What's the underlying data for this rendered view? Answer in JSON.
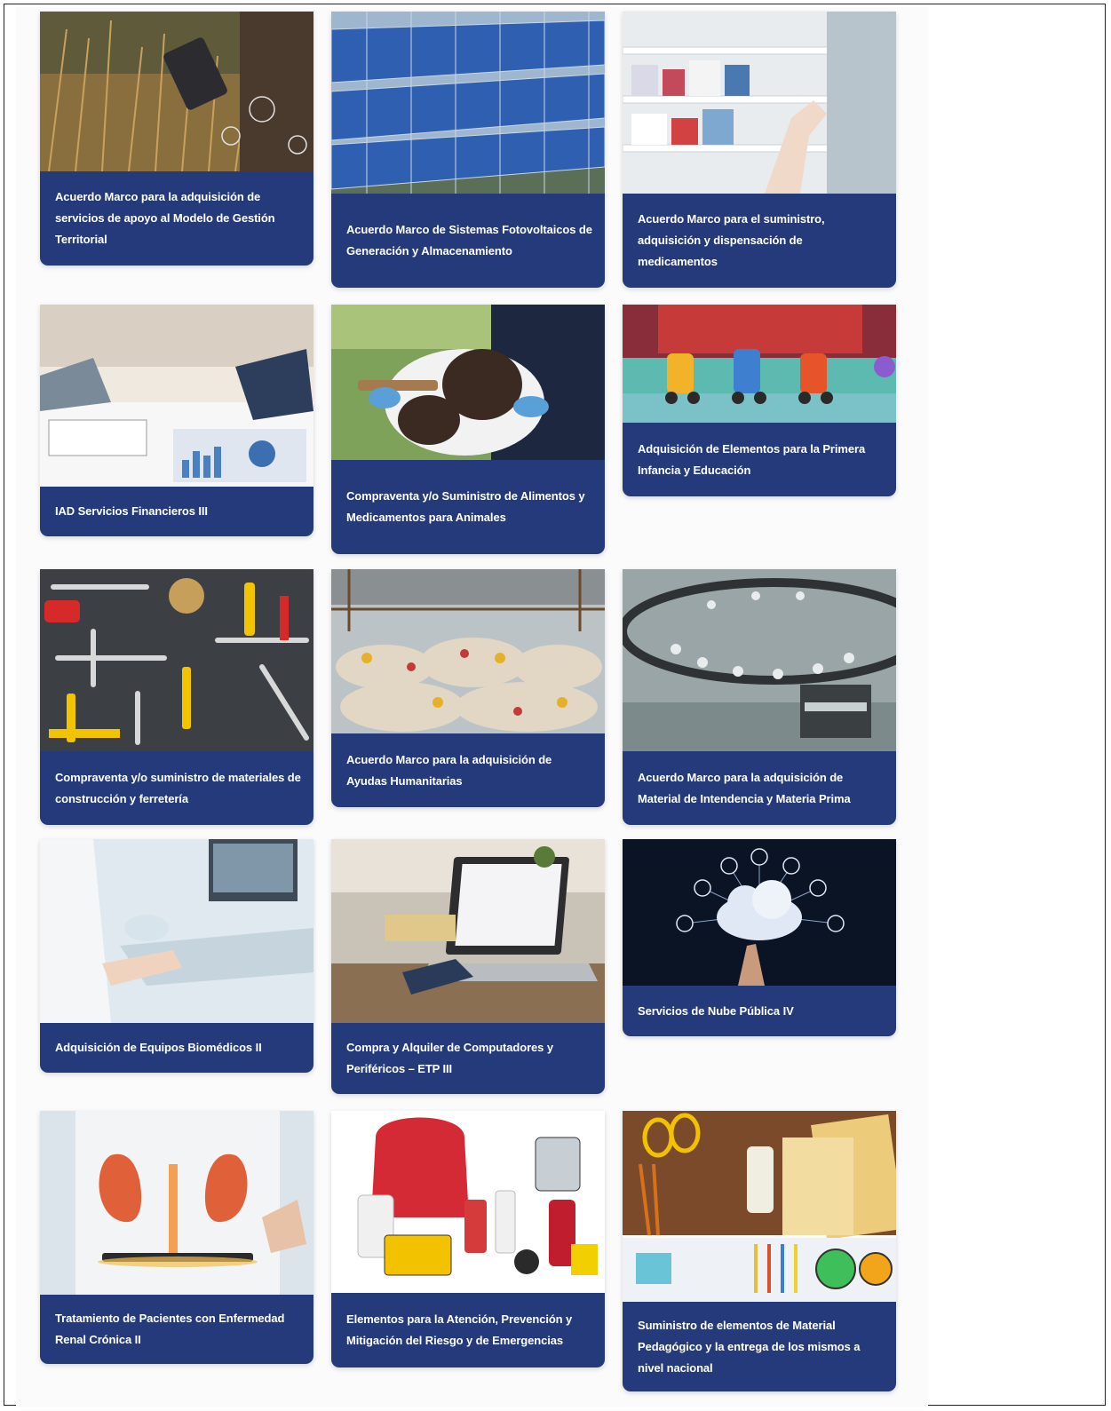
{
  "colors": {
    "caption_bg": "#243a7a",
    "caption_text": "#ffffff",
    "page_bg": "#fbfbfc"
  },
  "cards": [
    {
      "title": "Acuerdo Marco para la adquisición de servicios de apoyo al Modelo de Gestión Territorial",
      "image": "wheat-field-tablet"
    },
    {
      "title": "Acuerdo Marco de Sistemas Fotovoltaicos de Generación y Almacenamiento",
      "image": "solar-panels"
    },
    {
      "title": "Acuerdo Marco para el suministro, adquisición y dispensación de medicamentos",
      "image": "pharmacy-shelves"
    },
    {
      "title": "IAD Servicios Financieros III",
      "image": "financial-documents"
    },
    {
      "title": "Compraventa y/o Suministro de Alimentos y Medicamentos para Animales",
      "image": "calf-veterinarian"
    },
    {
      "title": "Adquisición de Elementos para la Primera Infancia y Educación",
      "image": "toy-numbers-train"
    },
    {
      "title": "Compraventa y/o suministro de materiales de construcción y ferretería",
      "image": "hardware-tools"
    },
    {
      "title": "Acuerdo Marco para la adquisición de Ayudas Humanitarias",
      "image": "humanitarian-aid-bags"
    },
    {
      "title": "Acuerdo Marco para la adquisición de Material de Intendencia y Materia Prima",
      "image": "textile-machine"
    },
    {
      "title": "Adquisición de Equipos Biomédicos II",
      "image": "ultrasound-equipment"
    },
    {
      "title": "Compra y Alquiler de Computadores y Periféricos – ETP III",
      "image": "laptop-desk"
    },
    {
      "title": "Servicios de Nube Pública IV",
      "image": "cloud-network"
    },
    {
      "title": "Tratamiento de Pacientes con Enfermedad Renal Crónica II",
      "image": "kidneys-doctor"
    },
    {
      "title": "Elementos para la Atención, Prevención y Mitigación del Riesgo y de Emergencias",
      "image": "emergency-kit"
    },
    {
      "title": "Suministro de elementos de Material Pedagógico y la entrega de los mismos a nivel nacional",
      "image": "school-supplies"
    }
  ]
}
